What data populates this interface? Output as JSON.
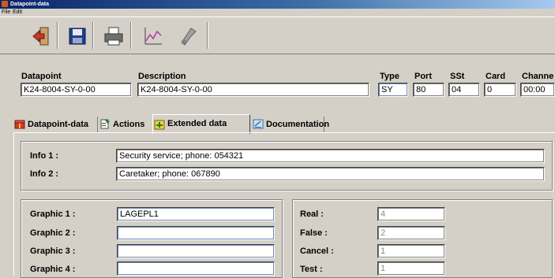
{
  "window": {
    "title": "Datapoint-data"
  },
  "menu": [
    "File",
    "Edit"
  ],
  "toolbar": {
    "buttons": [
      {
        "name": "exit-icon",
        "color": "#c0392b"
      },
      {
        "name": "save-icon",
        "color": "#1f3f8f"
      },
      {
        "name": "print-icon",
        "color": "#404040"
      },
      {
        "name": "chart-icon",
        "color": "#b5389e"
      },
      {
        "name": "tool-icon",
        "color": "#8a8a8a"
      }
    ]
  },
  "header": {
    "datapoint": {
      "label": "Datapoint",
      "value": "K24-8004-SY-0-00"
    },
    "description": {
      "label": "Description",
      "value": "K24-8004-SY-0-00"
    },
    "type": {
      "label": "Type",
      "value": "SY"
    },
    "port": {
      "label": "Port",
      "value": "80"
    },
    "sst": {
      "label": "SSt",
      "value": "04"
    },
    "card": {
      "label": "Card",
      "value": "0"
    },
    "channel": {
      "label": "Channe",
      "value": "00:00"
    }
  },
  "tabs": [
    {
      "label": "Datapoint-data",
      "icon": "gift-icon",
      "active": false
    },
    {
      "label": "Actions",
      "icon": "actions-icon",
      "active": false
    },
    {
      "label": "Extended data",
      "icon": "extended-data-icon",
      "active": true
    },
    {
      "label": "Documentation",
      "icon": "documentation-icon",
      "active": false
    }
  ],
  "info": [
    {
      "label": "Info 1 :",
      "value": "Security service; phone: 054321"
    },
    {
      "label": "Info 2 :",
      "value": "Caretaker; phone: 067890"
    }
  ],
  "graphics": [
    {
      "label": "Graphic 1 :",
      "value": "LAGEPL1"
    },
    {
      "label": "Graphic 2 :",
      "value": ""
    },
    {
      "label": "Graphic 3 :",
      "value": ""
    },
    {
      "label": "Graphic 4 :",
      "value": ""
    }
  ],
  "states": [
    {
      "label": "Real :",
      "value": "4"
    },
    {
      "label": "False :",
      "value": "2"
    },
    {
      "label": "Cancel :",
      "value": "1"
    },
    {
      "label": "Test :",
      "value": "1"
    }
  ]
}
